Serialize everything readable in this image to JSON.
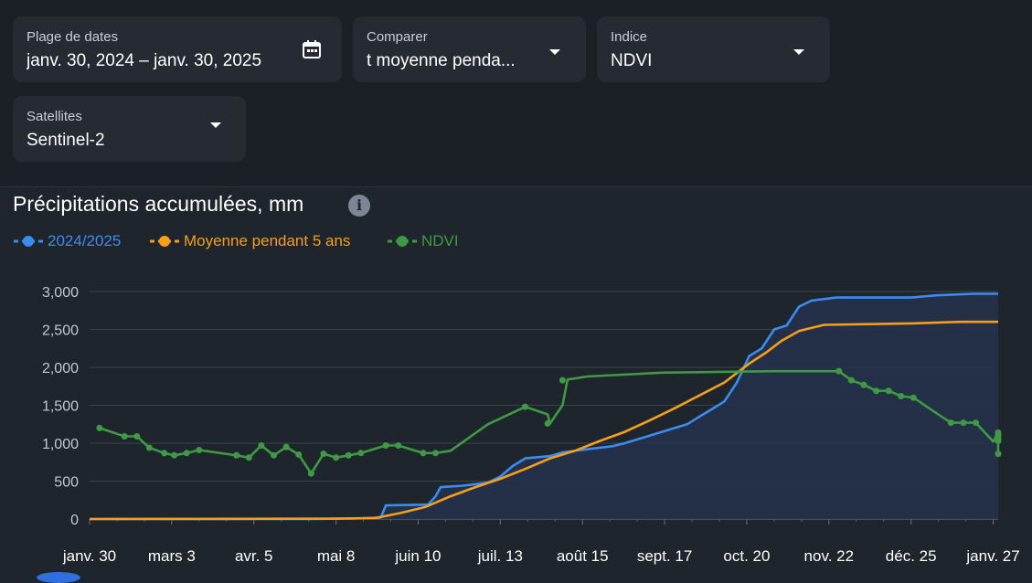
{
  "filters": {
    "date_range": {
      "label": "Plage de dates",
      "value": "janv. 30, 2024 – janv. 30, 2025",
      "icon": "calendar-icon"
    },
    "compare": {
      "label": "Comparer",
      "value": "t moyenne penda..."
    },
    "index": {
      "label": "Indice",
      "value": "NDVI"
    },
    "satellite": {
      "label": "Satellites",
      "value": "Sentinel-2"
    }
  },
  "chart_title": "Précipitations accumulées, mm",
  "info_icon": "i",
  "legend": [
    {
      "label": "2024/2025",
      "color": "#3b8cf0"
    },
    {
      "label": "Moyenne pendant 5 ans",
      "color": "#f59f1a"
    },
    {
      "label": "NDVI",
      "color": "#3f9a43"
    }
  ],
  "chart_data": {
    "type": "line",
    "title": "Précipitations accumulées, mm",
    "xlabel": "",
    "ylabel": "",
    "x_ticks": [
      "janv. 30",
      "mars 3",
      "avr. 5",
      "mai 8",
      "juin 10",
      "juil. 13",
      "août 15",
      "sept. 17",
      "oct. 20",
      "nov. 22",
      "déc. 25",
      "janv. 27"
    ],
    "y_ticks": [
      "3,000",
      "2,500",
      "2,000",
      "1,500",
      "1,000",
      "500",
      "0"
    ],
    "ylim": [
      0,
      3000
    ],
    "xlim_days": [
      0,
      365
    ],
    "x_unit": "days from janv. 30",
    "grid": true,
    "legend_position": "top-left",
    "series": [
      {
        "name": "2024/2025",
        "color": "#3b8cf0",
        "area_fill": true,
        "points": [
          [
            0,
            0
          ],
          [
            90,
            0
          ],
          [
            100,
            5
          ],
          [
            110,
            10
          ],
          [
            117,
            20
          ],
          [
            119,
            180
          ],
          [
            136,
            190
          ],
          [
            139,
            300
          ],
          [
            141,
            420
          ],
          [
            150,
            440
          ],
          [
            160,
            480
          ],
          [
            165,
            560
          ],
          [
            170,
            700
          ],
          [
            175,
            800
          ],
          [
            185,
            830
          ],
          [
            190,
            880
          ],
          [
            200,
            920
          ],
          [
            210,
            960
          ],
          [
            215,
            1000
          ],
          [
            225,
            1100
          ],
          [
            235,
            1200
          ],
          [
            240,
            1250
          ],
          [
            245,
            1350
          ],
          [
            250,
            1450
          ],
          [
            255,
            1550
          ],
          [
            260,
            1800
          ],
          [
            265,
            2150
          ],
          [
            270,
            2250
          ],
          [
            275,
            2500
          ],
          [
            280,
            2550
          ],
          [
            285,
            2800
          ],
          [
            290,
            2880
          ],
          [
            300,
            2920
          ],
          [
            330,
            2920
          ],
          [
            340,
            2950
          ],
          [
            355,
            2970
          ],
          [
            365,
            2970
          ]
        ]
      },
      {
        "name": "Moyenne pendant 5 ans",
        "color": "#f59f1a",
        "area_fill": false,
        "points": [
          [
            0,
            0
          ],
          [
            100,
            5
          ],
          [
            115,
            15
          ],
          [
            125,
            80
          ],
          [
            135,
            160
          ],
          [
            145,
            300
          ],
          [
            155,
            420
          ],
          [
            165,
            530
          ],
          [
            175,
            660
          ],
          [
            185,
            800
          ],
          [
            195,
            900
          ],
          [
            205,
            1030
          ],
          [
            215,
            1150
          ],
          [
            225,
            1300
          ],
          [
            235,
            1460
          ],
          [
            245,
            1630
          ],
          [
            255,
            1800
          ],
          [
            265,
            2050
          ],
          [
            272,
            2200
          ],
          [
            278,
            2350
          ],
          [
            285,
            2480
          ],
          [
            295,
            2560
          ],
          [
            330,
            2580
          ],
          [
            350,
            2600
          ],
          [
            365,
            2600
          ]
        ]
      },
      {
        "name": "NDVI",
        "color": "#3f9a43",
        "area_fill": false,
        "points": [
          [
            4,
            1200
          ],
          [
            14,
            1090
          ],
          [
            19,
            1090
          ],
          [
            24,
            940
          ],
          [
            30,
            870
          ],
          [
            34,
            840
          ],
          [
            39,
            870
          ],
          [
            44,
            910
          ],
          [
            59,
            840
          ],
          [
            64,
            810
          ],
          [
            69,
            970
          ],
          [
            74,
            840
          ],
          [
            79,
            950
          ],
          [
            84,
            850
          ],
          [
            89,
            600
          ],
          [
            94,
            860
          ],
          [
            99,
            810
          ],
          [
            104,
            840
          ],
          [
            109,
            870
          ],
          [
            119,
            970
          ],
          [
            124,
            970
          ],
          [
            134,
            870
          ],
          [
            139,
            870
          ],
          [
            145,
            900
          ],
          [
            160,
            1250
          ],
          [
            175,
            1480
          ],
          [
            184,
            1380
          ],
          [
            185,
            1260
          ],
          [
            190,
            1500
          ],
          [
            192,
            1840
          ],
          [
            200,
            1880
          ],
          [
            230,
            1930
          ],
          [
            275,
            1950
          ],
          [
            301,
            1950
          ],
          [
            306,
            1830
          ],
          [
            311,
            1770
          ],
          [
            316,
            1690
          ],
          [
            321,
            1690
          ],
          [
            326,
            1620
          ],
          [
            331,
            1600
          ],
          [
            340,
            1400
          ],
          [
            346,
            1270
          ],
          [
            351,
            1270
          ],
          [
            356,
            1270
          ],
          [
            366,
            1140
          ],
          [
            371,
            1110
          ],
          [
            376,
            1100
          ],
          [
            381,
            860
          ],
          [
            386,
            1060
          ],
          [
            390,
            1040
          ],
          [
            363,
            1020
          ]
        ],
        "marker_points": [
          [
            4,
            1200
          ],
          [
            14,
            1090
          ],
          [
            19,
            1090
          ],
          [
            24,
            940
          ],
          [
            30,
            870
          ],
          [
            34,
            840
          ],
          [
            39,
            870
          ],
          [
            44,
            910
          ],
          [
            59,
            840
          ],
          [
            64,
            810
          ],
          [
            69,
            970
          ],
          [
            74,
            840
          ],
          [
            79,
            950
          ],
          [
            84,
            850
          ],
          [
            89,
            600
          ],
          [
            94,
            860
          ],
          [
            99,
            810
          ],
          [
            104,
            840
          ],
          [
            109,
            870
          ],
          [
            119,
            970
          ],
          [
            124,
            970
          ],
          [
            134,
            870
          ],
          [
            139,
            870
          ],
          [
            175,
            1480
          ],
          [
            184,
            1260
          ],
          [
            190,
            1830
          ],
          [
            301,
            1950
          ],
          [
            306,
            1830
          ],
          [
            311,
            1770
          ],
          [
            316,
            1690
          ],
          [
            321,
            1690
          ],
          [
            326,
            1620
          ],
          [
            331,
            1600
          ],
          [
            346,
            1270
          ],
          [
            351,
            1270
          ],
          [
            356,
            1270
          ],
          [
            366,
            1140
          ],
          [
            371,
            1110
          ],
          [
            376,
            1100
          ],
          [
            381,
            860
          ],
          [
            386,
            1060
          ],
          [
            390,
            1030
          ]
        ]
      }
    ]
  }
}
